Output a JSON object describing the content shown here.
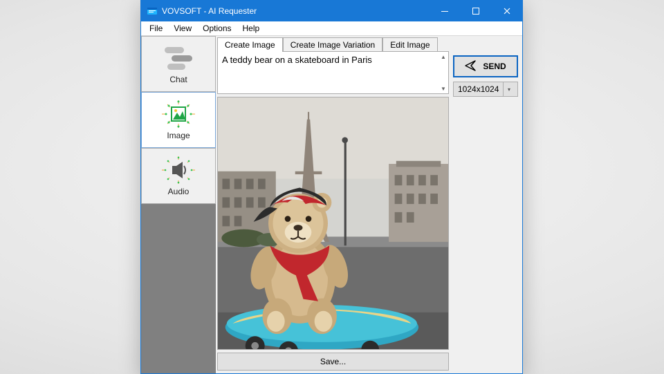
{
  "titlebar": {
    "title": "VOVSOFT - AI Requester"
  },
  "menubar": {
    "file": "File",
    "view": "View",
    "options": "Options",
    "help": "Help"
  },
  "rail": {
    "chat": {
      "label": "Chat"
    },
    "image": {
      "label": "Image"
    },
    "audio": {
      "label": "Audio"
    }
  },
  "tabs": {
    "create": "Create Image",
    "variation": "Create Image Variation",
    "edit": "Edit Image"
  },
  "prompt": {
    "text": "A teddy bear on a skateboard in Paris"
  },
  "buttons": {
    "save": "Save...",
    "send": "SEND"
  },
  "size_select": {
    "value": "1024x1024"
  }
}
